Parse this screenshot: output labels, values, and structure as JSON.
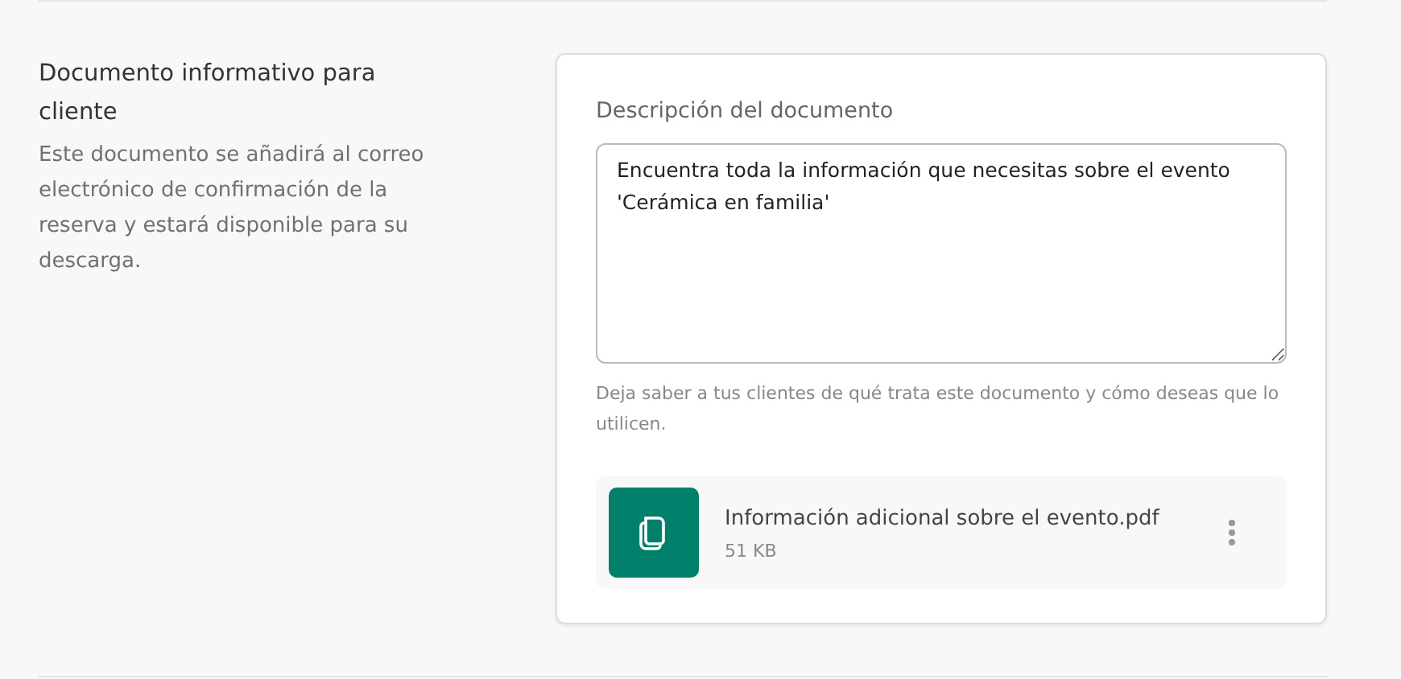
{
  "section": {
    "title": "Documento informativo para cliente",
    "description": "Este documento se añadirá al correo electrónico de confirmación de la reserva y estará disponible para su descarga."
  },
  "description_field": {
    "label": "Descripción del documento",
    "value": "Encuentra toda la información que necesitas sobre el evento 'Cerámica en familia'",
    "help": "Deja saber a tus clientes de qué trata este documento y cómo deseas que lo utilicen."
  },
  "attachment": {
    "name": "Información adicional sobre el evento.pdf",
    "size": "51 KB"
  }
}
